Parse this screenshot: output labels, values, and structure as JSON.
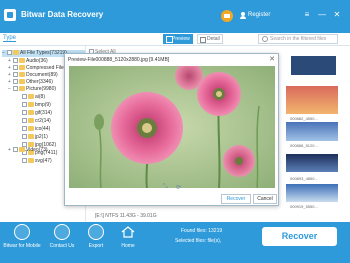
{
  "app": {
    "title": "Bitwar Data Recovery",
    "register_label": "Register"
  },
  "window_controls": {
    "menu": "≡",
    "minimize": "—",
    "close": "✕"
  },
  "toolbar": {
    "type_tab": "Type",
    "preview_label": "Preview",
    "detail_label": "Detail",
    "search_placeholder": "Search in the filtered files"
  },
  "tree": [
    {
      "label": "All File Types(73219)",
      "level": 0,
      "selected": true
    },
    {
      "label": "Audio(36)",
      "level": 1
    },
    {
      "label": "Compressed File",
      "level": 1
    },
    {
      "label": "Document(89)",
      "level": 1
    },
    {
      "label": "Other(3346)",
      "level": 1
    },
    {
      "label": "Picture(9980)",
      "level": 1
    },
    {
      "label": "ai(8)",
      "level": 2
    },
    {
      "label": "bmp(9)",
      "level": 2
    },
    {
      "label": "gif(314)",
      "level": 2
    },
    {
      "label": "cr2(14)",
      "level": 2
    },
    {
      "label": "ico(44)",
      "level": 2
    },
    {
      "label": "jp2(1)",
      "level": 2
    },
    {
      "label": "jpg(1062)",
      "level": 2
    },
    {
      "label": "png(7411)",
      "level": 2
    },
    {
      "label": "svg(47)",
      "level": 2
    },
    {
      "label": "Video(73)",
      "level": 1
    }
  ],
  "content": {
    "select_all": "Select All",
    "thumb_labels": [
      "000882_4550...",
      "000888_5120...",
      "000893_4850...",
      "000919_5550..."
    ]
  },
  "preview_dialog": {
    "title": "Preview-File000888_5120x2880.jpg [9.41MB]",
    "recover_button": "Recover",
    "cancel_button": "Cancel"
  },
  "status": {
    "drive_info": "[E:\\] NTFS 11.43G - 39.01G"
  },
  "bottom": {
    "items": [
      {
        "label": "Bitwar for Mobile",
        "icon": "phone-icon"
      },
      {
        "label": "Contact Us",
        "icon": "contact-icon"
      },
      {
        "label": "Export",
        "icon": "export-icon"
      },
      {
        "label": "Home",
        "icon": "home-icon"
      }
    ],
    "found_files": "Found files: 13219",
    "selected_files": "Selected files: file(s),",
    "recover_button": "Recover"
  },
  "colors": {
    "brand": "#2f9ad9",
    "accent_orange": "#f2a824",
    "tree_selected": "#bfe0f5"
  }
}
